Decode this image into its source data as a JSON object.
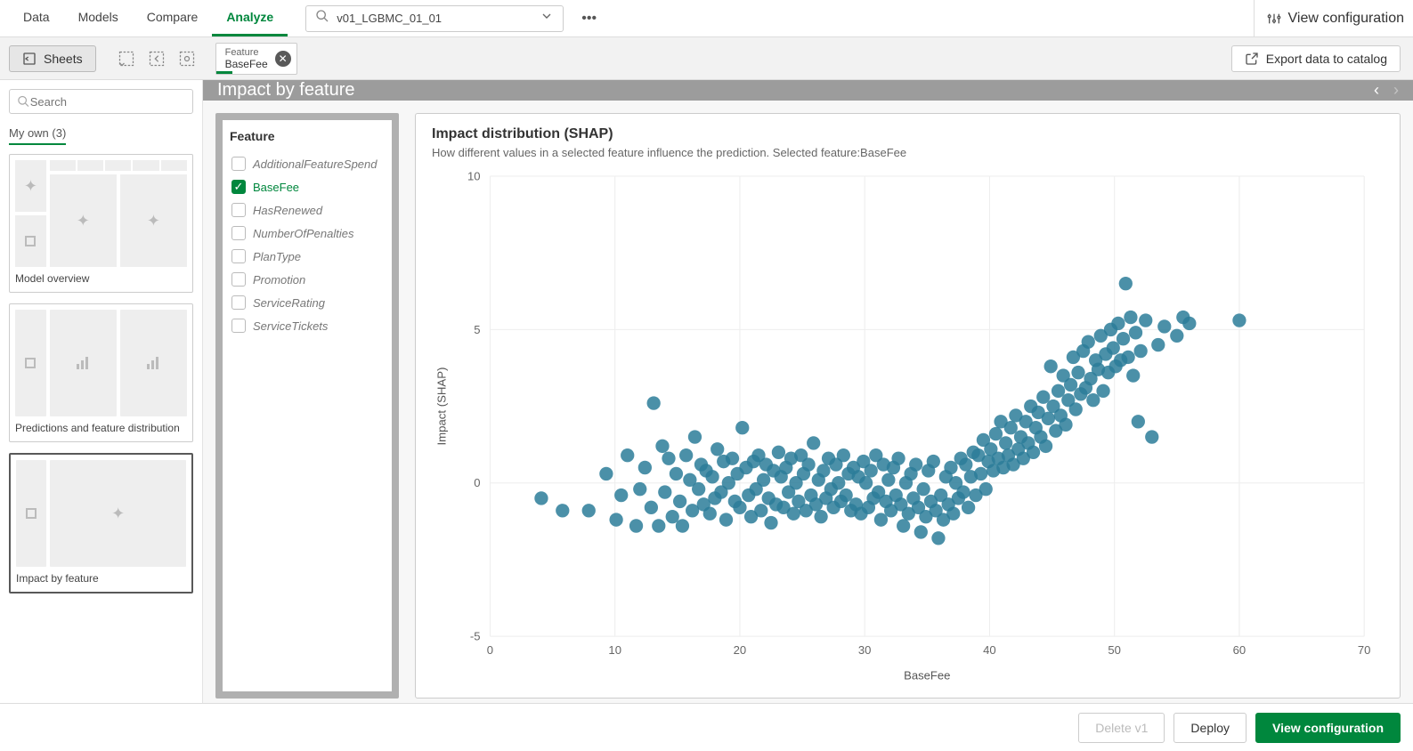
{
  "topnav": {
    "tabs": [
      "Data",
      "Models",
      "Compare",
      "Analyze"
    ],
    "active_tab": 3,
    "model_name": "v01_LGBMC_01_01",
    "view_config": "View configuration"
  },
  "toolbar": {
    "sheets_label": "Sheets",
    "chip_title": "Feature",
    "chip_value": "BaseFee",
    "export_label": "Export data to catalog"
  },
  "sidebar": {
    "search_placeholder": "Search",
    "section_label": "My own (3)",
    "sheets": [
      {
        "caption": "Model overview"
      },
      {
        "caption": "Predictions and feature distribution"
      },
      {
        "caption": "Impact by feature"
      }
    ],
    "selected_sheet": 2
  },
  "feature_panel": {
    "title": "Feature",
    "items": [
      "AdditionalFeatureSpend",
      "BaseFee",
      "HasRenewed",
      "NumberOfPenalties",
      "PlanType",
      "Promotion",
      "ServiceRating",
      "ServiceTickets"
    ],
    "selected": "BaseFee"
  },
  "panel_header": "Impact by feature",
  "chart": {
    "title": "Impact distribution (SHAP)",
    "subtitle": "How different values in a selected feature influence the prediction. Selected feature:BaseFee"
  },
  "chart_data": {
    "type": "scatter",
    "xlabel": "BaseFee",
    "ylabel": "Impact (SHAP)",
    "xlim": [
      0,
      70
    ],
    "ylim": [
      -5,
      10
    ],
    "x_ticks": [
      0,
      10,
      20,
      30,
      40,
      50,
      60,
      70
    ],
    "y_ticks": [
      -5,
      0,
      5,
      10
    ],
    "point_color": "#2b7c99",
    "series": [
      {
        "name": "SHAP",
        "points": [
          [
            4.1,
            -0.5
          ],
          [
            5.8,
            -0.9
          ],
          [
            7.9,
            -0.9
          ],
          [
            9.3,
            0.3
          ],
          [
            10.1,
            -1.2
          ],
          [
            10.5,
            -0.4
          ],
          [
            11.0,
            0.9
          ],
          [
            11.7,
            -1.4
          ],
          [
            12.0,
            -0.2
          ],
          [
            12.4,
            0.5
          ],
          [
            12.9,
            -0.8
          ],
          [
            13.1,
            2.6
          ],
          [
            13.5,
            -1.4
          ],
          [
            13.8,
            1.2
          ],
          [
            14.0,
            -0.3
          ],
          [
            14.3,
            0.8
          ],
          [
            14.6,
            -1.1
          ],
          [
            14.9,
            0.3
          ],
          [
            15.2,
            -0.6
          ],
          [
            15.4,
            -1.4
          ],
          [
            15.7,
            0.9
          ],
          [
            16.0,
            0.1
          ],
          [
            16.2,
            -0.9
          ],
          [
            16.4,
            1.5
          ],
          [
            16.7,
            -0.2
          ],
          [
            16.9,
            0.6
          ],
          [
            17.1,
            -0.7
          ],
          [
            17.3,
            0.4
          ],
          [
            17.6,
            -1.0
          ],
          [
            17.8,
            0.2
          ],
          [
            18.0,
            -0.5
          ],
          [
            18.2,
            1.1
          ],
          [
            18.5,
            -0.3
          ],
          [
            18.7,
            0.7
          ],
          [
            18.9,
            -1.2
          ],
          [
            19.1,
            0.0
          ],
          [
            19.4,
            0.8
          ],
          [
            19.6,
            -0.6
          ],
          [
            19.8,
            0.3
          ],
          [
            20.0,
            -0.8
          ],
          [
            20.2,
            1.8
          ],
          [
            20.5,
            0.5
          ],
          [
            20.7,
            -0.4
          ],
          [
            20.9,
            -1.1
          ],
          [
            21.1,
            0.7
          ],
          [
            21.3,
            -0.2
          ],
          [
            21.5,
            0.9
          ],
          [
            21.7,
            -0.9
          ],
          [
            21.9,
            0.1
          ],
          [
            22.1,
            0.6
          ],
          [
            22.3,
            -0.5
          ],
          [
            22.5,
            -1.3
          ],
          [
            22.7,
            0.4
          ],
          [
            22.9,
            -0.7
          ],
          [
            23.1,
            1.0
          ],
          [
            23.3,
            0.2
          ],
          [
            23.5,
            -0.8
          ],
          [
            23.7,
            0.5
          ],
          [
            23.9,
            -0.3
          ],
          [
            24.1,
            0.8
          ],
          [
            24.3,
            -1.0
          ],
          [
            24.5,
            0.0
          ],
          [
            24.7,
            -0.6
          ],
          [
            24.9,
            0.9
          ],
          [
            25.1,
            0.3
          ],
          [
            25.3,
            -0.9
          ],
          [
            25.5,
            0.6
          ],
          [
            25.7,
            -0.4
          ],
          [
            25.9,
            1.3
          ],
          [
            26.1,
            -0.7
          ],
          [
            26.3,
            0.1
          ],
          [
            26.5,
            -1.1
          ],
          [
            26.7,
            0.4
          ],
          [
            26.9,
            -0.5
          ],
          [
            27.1,
            0.8
          ],
          [
            27.3,
            -0.2
          ],
          [
            27.5,
            -0.8
          ],
          [
            27.7,
            0.6
          ],
          [
            27.9,
            0.0
          ],
          [
            28.1,
            -0.6
          ],
          [
            28.3,
            0.9
          ],
          [
            28.5,
            -0.4
          ],
          [
            28.7,
            0.3
          ],
          [
            28.9,
            -0.9
          ],
          [
            29.1,
            0.5
          ],
          [
            29.3,
            -0.7
          ],
          [
            29.5,
            0.2
          ],
          [
            29.7,
            -1.0
          ],
          [
            29.9,
            0.7
          ],
          [
            30.1,
            0.0
          ],
          [
            30.3,
            -0.8
          ],
          [
            30.5,
            0.4
          ],
          [
            30.7,
            -0.5
          ],
          [
            30.9,
            0.9
          ],
          [
            31.1,
            -0.3
          ],
          [
            31.3,
            -1.2
          ],
          [
            31.5,
            0.6
          ],
          [
            31.7,
            -0.6
          ],
          [
            31.9,
            0.1
          ],
          [
            32.1,
            -0.9
          ],
          [
            32.3,
            0.5
          ],
          [
            32.5,
            -0.4
          ],
          [
            32.7,
            0.8
          ],
          [
            32.9,
            -0.7
          ],
          [
            33.1,
            -1.4
          ],
          [
            33.3,
            0.0
          ],
          [
            33.5,
            -1.0
          ],
          [
            33.7,
            0.3
          ],
          [
            33.9,
            -0.5
          ],
          [
            34.1,
            0.6
          ],
          [
            34.3,
            -0.8
          ],
          [
            34.5,
            -1.6
          ],
          [
            34.7,
            -0.2
          ],
          [
            34.9,
            -1.1
          ],
          [
            35.1,
            0.4
          ],
          [
            35.3,
            -0.6
          ],
          [
            35.5,
            0.7
          ],
          [
            35.7,
            -0.9
          ],
          [
            35.9,
            -1.8
          ],
          [
            36.1,
            -0.4
          ],
          [
            36.3,
            -1.2
          ],
          [
            36.5,
            0.2
          ],
          [
            36.7,
            -0.7
          ],
          [
            36.9,
            0.5
          ],
          [
            37.1,
            -1.0
          ],
          [
            37.3,
            0.0
          ],
          [
            37.5,
            -0.5
          ],
          [
            37.7,
            0.8
          ],
          [
            37.9,
            -0.3
          ],
          [
            38.1,
            0.6
          ],
          [
            38.3,
            -0.8
          ],
          [
            38.5,
            0.2
          ],
          [
            38.7,
            1.0
          ],
          [
            38.9,
            -0.4
          ],
          [
            39.1,
            0.9
          ],
          [
            39.3,
            0.3
          ],
          [
            39.5,
            1.4
          ],
          [
            39.7,
            -0.2
          ],
          [
            39.9,
            0.7
          ],
          [
            40.1,
            1.1
          ],
          [
            40.3,
            0.4
          ],
          [
            40.5,
            1.6
          ],
          [
            40.7,
            0.8
          ],
          [
            40.9,
            2.0
          ],
          [
            41.1,
            0.5
          ],
          [
            41.3,
            1.3
          ],
          [
            41.5,
            0.9
          ],
          [
            41.7,
            1.8
          ],
          [
            41.9,
            0.6
          ],
          [
            42.1,
            2.2
          ],
          [
            42.3,
            1.1
          ],
          [
            42.5,
            1.5
          ],
          [
            42.7,
            0.8
          ],
          [
            42.9,
            2.0
          ],
          [
            43.1,
            1.3
          ],
          [
            43.3,
            2.5
          ],
          [
            43.5,
            1.0
          ],
          [
            43.7,
            1.8
          ],
          [
            43.9,
            2.3
          ],
          [
            44.1,
            1.5
          ],
          [
            44.3,
            2.8
          ],
          [
            44.5,
            1.2
          ],
          [
            44.7,
            2.1
          ],
          [
            44.9,
            3.8
          ],
          [
            45.1,
            2.5
          ],
          [
            45.3,
            1.7
          ],
          [
            45.5,
            3.0
          ],
          [
            45.7,
            2.2
          ],
          [
            45.9,
            3.5
          ],
          [
            46.1,
            1.9
          ],
          [
            46.3,
            2.7
          ],
          [
            46.5,
            3.2
          ],
          [
            46.7,
            4.1
          ],
          [
            46.9,
            2.4
          ],
          [
            47.1,
            3.6
          ],
          [
            47.3,
            2.9
          ],
          [
            47.5,
            4.3
          ],
          [
            47.7,
            3.1
          ],
          [
            47.9,
            4.6
          ],
          [
            48.1,
            3.4
          ],
          [
            48.3,
            2.7
          ],
          [
            48.5,
            4.0
          ],
          [
            48.7,
            3.7
          ],
          [
            48.9,
            4.8
          ],
          [
            49.1,
            3.0
          ],
          [
            49.3,
            4.2
          ],
          [
            49.5,
            3.6
          ],
          [
            49.7,
            5.0
          ],
          [
            49.9,
            4.4
          ],
          [
            50.1,
            3.8
          ],
          [
            50.3,
            5.2
          ],
          [
            50.5,
            4.0
          ],
          [
            50.7,
            4.7
          ],
          [
            50.9,
            6.5
          ],
          [
            51.1,
            4.1
          ],
          [
            51.3,
            5.4
          ],
          [
            51.5,
            3.5
          ],
          [
            51.7,
            4.9
          ],
          [
            51.9,
            2.0
          ],
          [
            52.1,
            4.3
          ],
          [
            52.5,
            5.3
          ],
          [
            53.0,
            1.5
          ],
          [
            53.5,
            4.5
          ],
          [
            54.0,
            5.1
          ],
          [
            55.0,
            4.8
          ],
          [
            55.5,
            5.4
          ],
          [
            56.0,
            5.2
          ],
          [
            60.0,
            5.3
          ]
        ]
      }
    ]
  },
  "footer": {
    "delete_label": "Delete v1",
    "deploy_label": "Deploy",
    "view_config_label": "View configuration"
  }
}
